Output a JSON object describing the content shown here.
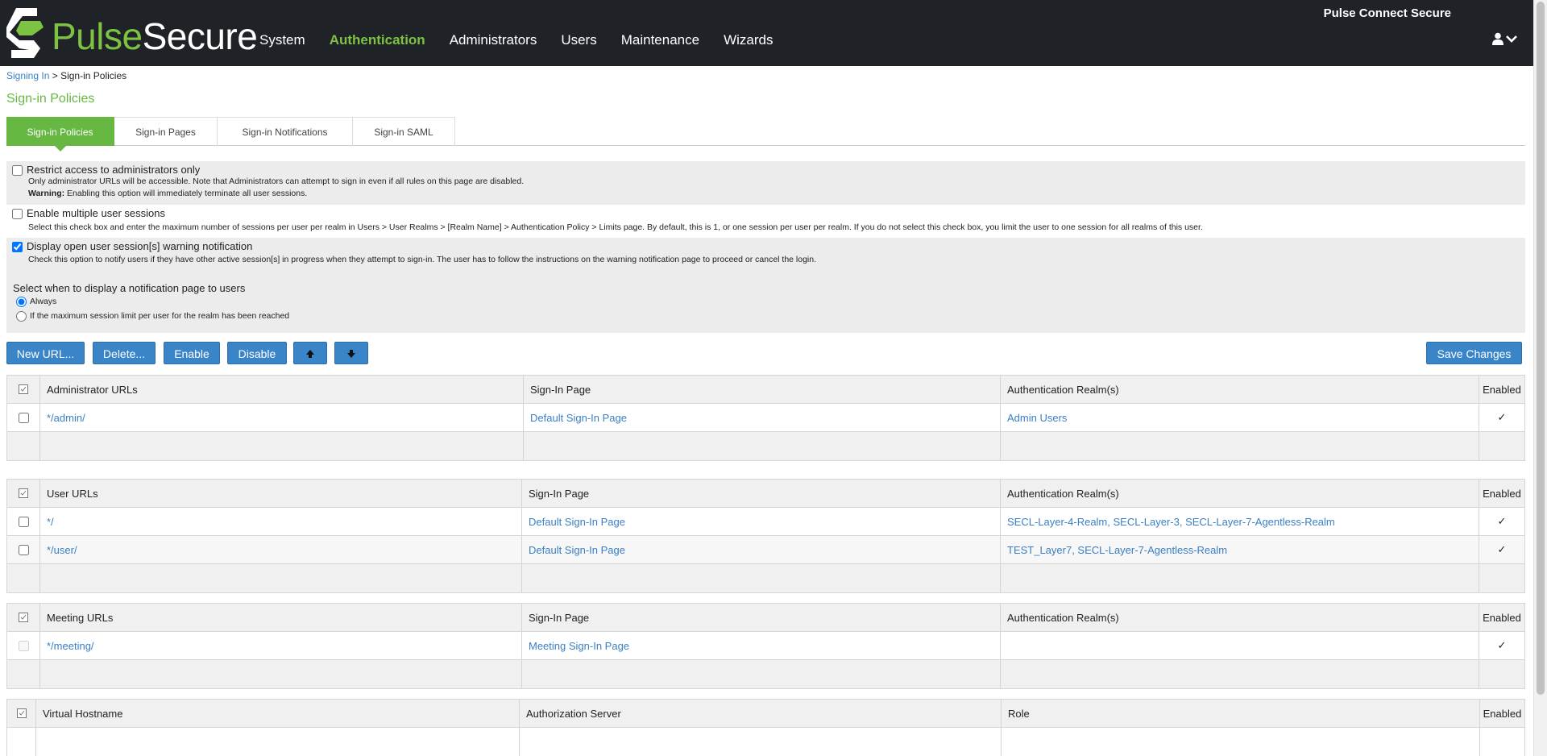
{
  "header": {
    "brand_green": "Pulse",
    "brand_white": "Secure",
    "product": "Pulse Connect Secure",
    "nav": [
      "System",
      "Authentication",
      "Administrators",
      "Users",
      "Maintenance",
      "Wizards"
    ],
    "active_nav": "Authentication",
    "accent_color": "#66b843"
  },
  "breadcrumb": {
    "parent": "Signing In",
    "separator": ">",
    "current": "Sign-in Policies"
  },
  "page_title": "Sign-in Policies",
  "tabs": [
    "Sign-in Policies",
    "Sign-in Pages",
    "Sign-in Notifications",
    "Sign-in SAML"
  ],
  "options": {
    "restrict_admin": {
      "label": "Restrict access to administrators only",
      "checked": false,
      "desc": "Only administrator URLs will be accessible. Note that Administrators can attempt to sign in even if all rules on this page are disabled.",
      "warning_label": "Warning:",
      "warning_text": "Enabling this option will immediately terminate all user sessions."
    },
    "multiple_sessions": {
      "label": "Enable multiple user sessions",
      "checked": false,
      "desc": "Select this check box and enter the maximum number of sessions per user per realm in Users > User Realms > [Realm Name] > Authentication Policy > Limits page. By default, this is 1, or one session per user per realm. If you do not select this check box, you limit the user to one session for all realms of this user."
    },
    "warning_notification": {
      "label": "Display open user session[s] warning notification",
      "checked": true,
      "desc": "Check this option to notify users if they have other active session[s] in progress when they attempt to sign-in. The user has to follow the instructions on the warning notification page to proceed or cancel the login."
    },
    "notify_when": {
      "label": "Select when to display a notification page to users",
      "choices": [
        "Always",
        "If the maximum session limit per user for the realm has been reached"
      ],
      "selected": "Always"
    }
  },
  "toolbar": {
    "new_url": "New URL...",
    "delete": "Delete...",
    "enable": "Enable",
    "disable": "Disable",
    "save": "Save Changes"
  },
  "admin_table": {
    "headers": [
      "Administrator URLs",
      "Sign-In Page",
      "Authentication Realm(s)",
      "Enabled"
    ],
    "rows": [
      {
        "url": "*/admin/",
        "page": "Default Sign-In Page",
        "realms": "Admin Users",
        "enabled": "✓"
      }
    ]
  },
  "user_table": {
    "headers": [
      "User URLs",
      "Sign-In Page",
      "Authentication Realm(s)",
      "Enabled"
    ],
    "rows": [
      {
        "url": "*/",
        "page": "Default Sign-In Page",
        "realms": "SECL-Layer-4-Realm, SECL-Layer-3, SECL-Layer-7-Agentless-Realm",
        "enabled": "✓"
      },
      {
        "url": "*/user/",
        "page": "Default Sign-In Page",
        "realms": "TEST_Layer7, SECL-Layer-7-Agentless-Realm",
        "enabled": "✓"
      }
    ]
  },
  "meeting_table": {
    "headers": [
      "Meeting URLs",
      "Sign-In Page",
      "Authentication Realm(s)",
      "Enabled"
    ],
    "rows": [
      {
        "url": "*/meeting/",
        "page": "Meeting Sign-In Page",
        "realms": "",
        "enabled": "✓"
      }
    ]
  },
  "vhost_table": {
    "headers": [
      "Virtual Hostname",
      "Authorization Server",
      "Role",
      "Enabled"
    ]
  }
}
